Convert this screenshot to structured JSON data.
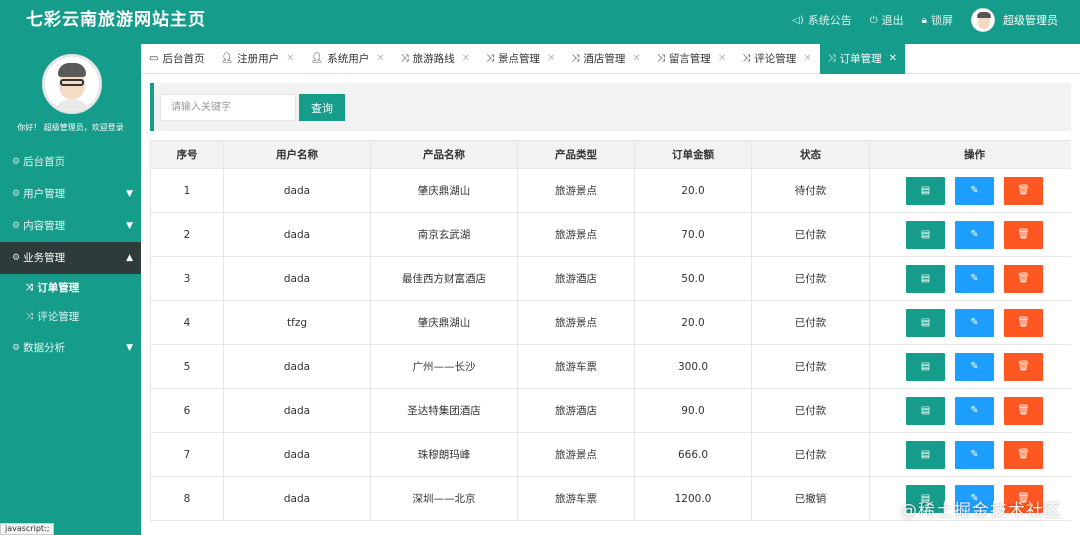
{
  "header": {
    "title": "七彩云南旅游网站主页",
    "nav": [
      {
        "label": "系统公告",
        "icon": "speaker-icon"
      },
      {
        "label": "退出",
        "icon": "power-icon"
      },
      {
        "label": "锁屏",
        "icon": "lock-icon"
      }
    ],
    "user": "超级管理员"
  },
  "sidebar": {
    "welcome": "你好！ 超级管理员，欢迎登录",
    "items": [
      {
        "label": "后台首页"
      },
      {
        "label": "用户管理"
      },
      {
        "label": "内容管理"
      },
      {
        "label": "业务管理"
      },
      {
        "label": "订单管理"
      },
      {
        "label": "评论管理"
      },
      {
        "label": "数据分析"
      }
    ]
  },
  "tabs": [
    {
      "label": "后台首页"
    },
    {
      "label": "注册用户"
    },
    {
      "label": "系统用户"
    },
    {
      "label": "旅游路线"
    },
    {
      "label": "景点管理"
    },
    {
      "label": "酒店管理"
    },
    {
      "label": "留言管理"
    },
    {
      "label": "评论管理"
    },
    {
      "label": "订单管理"
    }
  ],
  "search": {
    "placeholder": "请输入关键字",
    "button": "查询"
  },
  "table": {
    "headers": [
      "序号",
      "用户名称",
      "产品名称",
      "产品类型",
      "订单金额",
      "状态",
      "操作"
    ],
    "rows": [
      [
        "1",
        "dada",
        "肇庆鼎湖山",
        "旅游景点",
        "20.0",
        "待付款"
      ],
      [
        "2",
        "dada",
        "南京玄武湖",
        "旅游景点",
        "70.0",
        "已付款"
      ],
      [
        "3",
        "dada",
        "最佳西方财富酒店",
        "旅游酒店",
        "50.0",
        "已付款"
      ],
      [
        "4",
        "tfzg",
        "肇庆鼎湖山",
        "旅游景点",
        "20.0",
        "已付款"
      ],
      [
        "5",
        "dada",
        "广州——长沙",
        "旅游车票",
        "300.0",
        "已付款"
      ],
      [
        "6",
        "dada",
        "圣达特集团酒店",
        "旅游酒店",
        "90.0",
        "已付款"
      ],
      [
        "7",
        "dada",
        "珠穆朗玛峰",
        "旅游景点",
        "666.0",
        "已付款"
      ],
      [
        "8",
        "dada",
        "深圳——北京",
        "旅游车票",
        "1200.0",
        "已撤销"
      ]
    ]
  },
  "watermark": "@稀土掘金技术社区",
  "status_tip": "javascript:;"
}
